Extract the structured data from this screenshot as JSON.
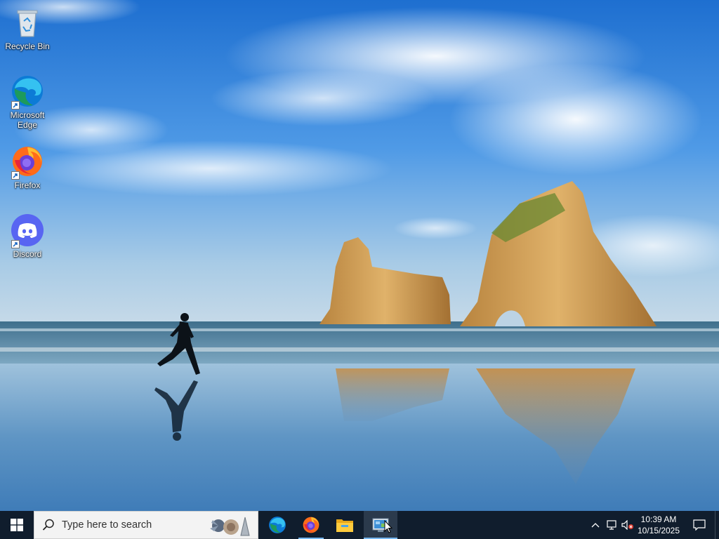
{
  "desktop": {
    "icons": [
      {
        "label": "Recycle Bin",
        "icon": "recycle-bin-icon"
      },
      {
        "label": "Microsoft Edge",
        "icon": "edge-icon"
      },
      {
        "label": "Firefox",
        "icon": "firefox-icon"
      },
      {
        "label": "Discord",
        "icon": "discord-icon"
      }
    ]
  },
  "taskbar": {
    "start_icon": "windows-logo-icon",
    "search_placeholder": "Type here to search",
    "pinned": [
      {
        "name": "Microsoft Edge",
        "icon": "edge-icon"
      },
      {
        "name": "Firefox",
        "icon": "firefox-icon"
      },
      {
        "name": "File Explorer",
        "icon": "folder-icon"
      },
      {
        "name": "Control Panel",
        "icon": "control-panel-icon"
      }
    ],
    "tray": {
      "time": "10:39 AM",
      "date": "10/15/2025",
      "icons": [
        "chevron-up-icon",
        "network-icon",
        "volume-muted-icon",
        "notification-icon"
      ]
    }
  },
  "colors": {
    "taskbar_bg": "#101d2d",
    "accent": "#77b7f0"
  }
}
